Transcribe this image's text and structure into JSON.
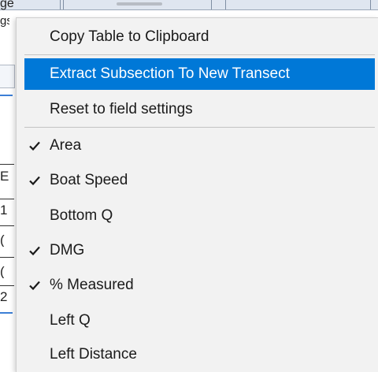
{
  "background_fragments": {
    "header_partial_text": "ge",
    "row_fragment_1": "gs",
    "row_fragment_2": "E",
    "row_fragment_3": "1",
    "row_fragment_4": "(",
    "row_fragment_5": "(",
    "row_fragment_6": "2"
  },
  "context_menu": {
    "items": [
      {
        "label": "Copy Table to Clipboard",
        "checked": false,
        "highlighted": false
      },
      {
        "label": "Extract Subsection To New Transect",
        "checked": false,
        "highlighted": true
      },
      {
        "label": "Reset to field settings",
        "checked": false,
        "highlighted": false
      },
      {
        "label": "Area",
        "checked": true,
        "highlighted": false
      },
      {
        "label": "Boat Speed",
        "checked": true,
        "highlighted": false
      },
      {
        "label": "Bottom Q",
        "checked": false,
        "highlighted": false
      },
      {
        "label": "DMG",
        "checked": true,
        "highlighted": false
      },
      {
        "label": "% Measured",
        "checked": true,
        "highlighted": false
      },
      {
        "label": "Left Q",
        "checked": false,
        "highlighted": false
      },
      {
        "label": "Left Distance",
        "checked": false,
        "highlighted": false
      }
    ]
  },
  "colors": {
    "menu_background": "#f2f2f2",
    "highlight": "#0078d7",
    "highlight_text": "#ffffff",
    "text": "#1a1a1a"
  },
  "icons": {
    "check": "checkmark-icon"
  }
}
